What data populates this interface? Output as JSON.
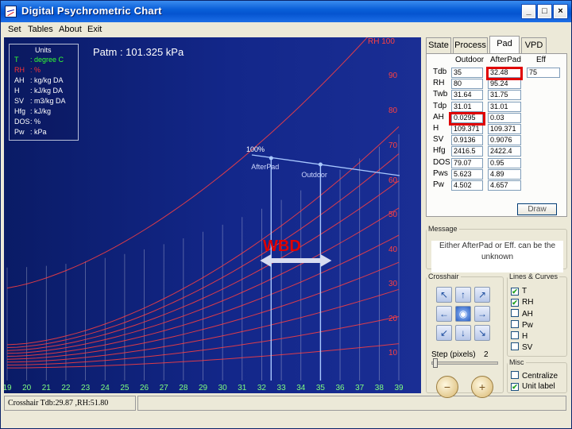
{
  "window": {
    "title": "Digital Psychrometric Chart",
    "minimize": "_",
    "maximize": "□",
    "close": "×"
  },
  "menu": [
    "Set",
    "Tables",
    "About",
    "Exit"
  ],
  "units": {
    "title": "Units",
    "rows": [
      {
        "sym": "T",
        "unit": ": degree C",
        "color": "#33ff33"
      },
      {
        "sym": "RH",
        "unit": ": %",
        "color": "#ff3333"
      },
      {
        "sym": "AH",
        "unit": ": kg/kg DA",
        "color": "#ffffff"
      },
      {
        "sym": "H",
        "unit": ": kJ/kg DA",
        "color": "#ffffff"
      },
      {
        "sym": "SV",
        "unit": ": m3/kg DA",
        "color": "#ffffff"
      },
      {
        "sym": "Hfg",
        "unit": ": kJ/kg",
        "color": "#ffffff"
      },
      {
        "sym": "DOS",
        "unit": ": %",
        "color": "#ffffff"
      },
      {
        "sym": "Pw",
        "unit": ": kPa",
        "color": "#ffffff"
      }
    ]
  },
  "patm": "Patm : 101.325 kPa",
  "chart_data": {
    "type": "line",
    "x_ticks": [
      "19",
      "20",
      "21",
      "22",
      "23",
      "24",
      "25",
      "26",
      "27",
      "28",
      "29",
      "30",
      "31",
      "32",
      "33",
      "34",
      "35",
      "36",
      "37",
      "38",
      "39"
    ],
    "rh_labels": [
      "RH 100",
      "90",
      "80",
      "70",
      "60",
      "50",
      "40",
      "30",
      "20",
      "10"
    ],
    "saturation_label": "100%",
    "process": {
      "points": [
        {
          "name": "AfterPad",
          "tdb": 32.48,
          "twb": 31.75
        },
        {
          "name": "Outdoor",
          "tdb": 35,
          "twb": 31.64
        }
      ]
    },
    "annotation": "WBD",
    "colors": {
      "rh": "#ff4040",
      "tdb": "#ffffff",
      "process": "#a8c8ff",
      "wbd": "#e00000",
      "arrow": "#d8dcf0"
    }
  },
  "status": "Crosshair  Tdb:29.87 ,RH:51.80",
  "tabs": [
    "State",
    "Process",
    "Pad",
    "VPD"
  ],
  "pad": {
    "headers": [
      "Outdoor",
      "AfterPad",
      "Eff"
    ],
    "rows": [
      {
        "label": "Tdb",
        "outdoor": "35",
        "afterpad": "32.48",
        "eff": "75"
      },
      {
        "label": "RH",
        "outdoor": "80",
        "afterpad": "95.24"
      },
      {
        "label": "Twb",
        "outdoor": "31.64",
        "afterpad": "31.75"
      },
      {
        "label": "Tdp",
        "outdoor": "31.01",
        "afterpad": "31.01"
      },
      {
        "label": "AH",
        "outdoor": "0.0295",
        "afterpad": "0.03"
      },
      {
        "label": "H",
        "outdoor": "109.371",
        "afterpad": "109.371"
      },
      {
        "label": "SV",
        "outdoor": "0.9136",
        "afterpad": "0.9076"
      },
      {
        "label": "Hfg",
        "outdoor": "2416.5",
        "afterpad": "2422.4"
      },
      {
        "label": "DOS",
        "outdoor": "79.07",
        "afterpad": "0.95"
      },
      {
        "label": "Pws",
        "outdoor": "5.623",
        "afterpad": "4.89"
      },
      {
        "label": "Pw",
        "outdoor": "4.502",
        "afterpad": "4.657"
      }
    ],
    "draw": "Draw"
  },
  "message": {
    "legend": "Message",
    "text": "Either AfterPad or Eff. can be the unknown"
  },
  "crosshair": {
    "legend": "Crosshair",
    "step_label": "Step (pixels)",
    "step_value": "2"
  },
  "lines": {
    "legend": "Lines & Curves",
    "items": [
      {
        "label": "T",
        "checked": "✔"
      },
      {
        "label": "RH",
        "checked": "✔"
      },
      {
        "label": "AH",
        "checked": ""
      },
      {
        "label": "Pw",
        "checked": ""
      },
      {
        "label": "H",
        "checked": ""
      },
      {
        "label": "SV",
        "checked": ""
      }
    ]
  },
  "misc": {
    "legend": "Misc",
    "items": [
      {
        "label": "Centralize",
        "checked": ""
      },
      {
        "label": "Unit label",
        "checked": "✔"
      }
    ]
  }
}
